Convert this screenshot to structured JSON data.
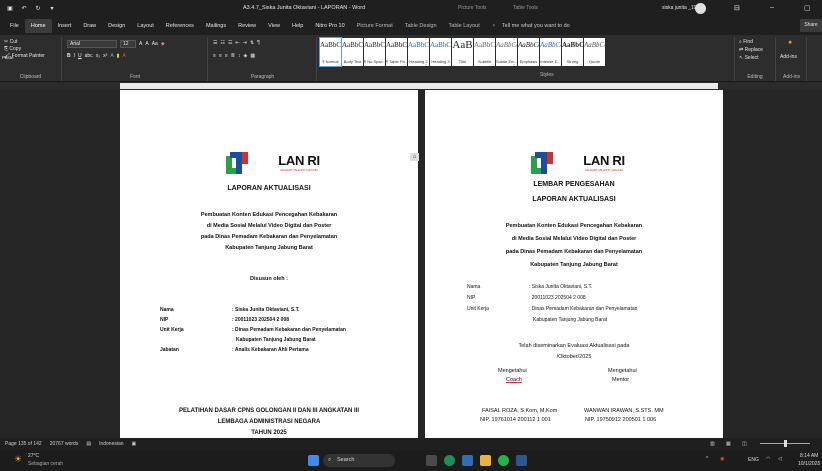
{
  "titlebar": {
    "document_title": "A3.4.7_Siska Junita Oktaviani - LAPORAN  -  Word",
    "picture_tools": "Picture Tools",
    "table_tools": "Table Tools",
    "user_name": "siska junita _19",
    "quick_access": [
      "save-icon",
      "undo-icon",
      "redo-icon",
      "more-icon"
    ]
  },
  "tabs": [
    "File",
    "Home",
    "Insert",
    "Draw",
    "Design",
    "Layout",
    "References",
    "Mailings",
    "Review",
    "View",
    "Help",
    "Nitro Pro 10",
    "Picture Format",
    "Table Design",
    "Table Layout"
  ],
  "active_tab": "Home",
  "tell_me": "Tell me what you want to do",
  "share": "Share",
  "ribbon": {
    "clipboard": {
      "label": "Clipboard",
      "paste": "Paste",
      "cut": "Cut",
      "copy": "Copy",
      "format_painter": "Format Painter"
    },
    "font": {
      "label": "Font",
      "name": "Arial",
      "size": "12"
    },
    "paragraph": {
      "label": "Paragraph"
    },
    "styles": {
      "label": "Styles",
      "items": [
        {
          "preview": "AaBbCcI",
          "name": "¶ Normal"
        },
        {
          "preview": "AaBbCc",
          "name": "Body Text"
        },
        {
          "preview": "AaBbCcI",
          "name": "¶ No Spac..."
        },
        {
          "preview": "AaBbCcI",
          "name": "¶ Table Pa..."
        },
        {
          "preview": "AaBbCc",
          "name": "Heading 2"
        },
        {
          "preview": "AaBbCc",
          "name": "Heading 3"
        },
        {
          "preview": "AaB",
          "name": "Title"
        },
        {
          "preview": "AaBbCc",
          "name": "Subtitle"
        },
        {
          "preview": "AaBbCcI",
          "name": "Subtle Em..."
        },
        {
          "preview": "AaBbCcI",
          "name": "Emphasis"
        },
        {
          "preview": "AaBbCcI",
          "name": "Intense E..."
        },
        {
          "preview": "AaBbCcI",
          "name": "Strong"
        },
        {
          "preview": "AaBbCcI",
          "name": "Quote"
        }
      ]
    },
    "editing": {
      "label": "Editing",
      "find": "Find",
      "replace": "Replace",
      "select": "Select"
    },
    "addins": {
      "label": "Add-ins",
      "button": "Add-ins"
    }
  },
  "page_left": {
    "logo_text": "LAN RI",
    "logo_tagline": "MAHARTI BHAKTI NAGARI",
    "heading": "LAPORAN AKTUALISASI",
    "subtitle_lines": [
      "Pembuatan Konten Edukasi Pencegahan Kebakaran",
      "di Media Sosial Melalui Video Digital dan Poster",
      "pada Dinas Pemadam Kebakaran dan Penyelamatan",
      "Kabupaten Tanjung Jabung Barat"
    ],
    "prepared_by": "Disusun oleh :",
    "fields": [
      {
        "label": "Nama",
        "value": ": Siska Junita Oktaviani, S.T."
      },
      {
        "label": "NIP",
        "value": ": 20011023 202504 2 008"
      },
      {
        "label": "Unit Kerja",
        "value": ": Dinas  Pemadam  Kebakaran  dan  Penyelamatan"
      },
      {
        "label": "",
        "value": "Kabupaten Tanjung Jabung Barat"
      },
      {
        "label": "Jabatan",
        "value": ": Analis Kebakaran Ahli Pertama"
      }
    ],
    "footer_lines": [
      "PELATIHAN DASAR CPNS GOLONGAN II DAN III ANGKATAN III",
      "LEMBAGA ADMINISTRASI NEGARA",
      "TAHUN 2025"
    ]
  },
  "page_right": {
    "logo_text": "LAN RI",
    "logo_tagline": "MAHARTI BHAKTI NAGARI",
    "heading1": "LEMBAR PENGESAHAN",
    "heading2": "LAPORAN AKTUALISASI",
    "subtitle_lines": [
      "Pembuatan Konten Edukasi Pencegahan Kebakaran",
      "di Media Sosial Melalui Video Digital dan Poster",
      "pada Dinas Pemadam Kebakaran dan Penyelamatan",
      "Kabupaten Tanjung Jabung Barat"
    ],
    "fields": [
      {
        "label": "Nama",
        "value": ": Siska Junita Oktaviani, S.T."
      },
      {
        "label": "NIP",
        "value": ": 20011023 202504 2 008"
      },
      {
        "label": "Unit Kerja",
        "value": ": Dinas   Pemadam   Kebakaran   dan   Penyelamatan"
      },
      {
        "label": "",
        "value": "Kabupaten Tanjung Jabung Barat"
      }
    ],
    "seminar_lines": [
      "Telah diseminarkan Evaluasi Aktualisasi pada",
      "/Oktober/2025"
    ],
    "sign_left_title": "Mengetahui",
    "sign_left_role": "Coach",
    "sign_right_title": "Mengetahui",
    "sign_right_role": "Mentor",
    "sign_left_name": "FAISAL ROZA, S.Kom, M.Kom",
    "sign_left_nip": "NIP. 19761014 200112 1 001",
    "sign_right_name": "WANWAN IRAWAN, S.STS. MM",
    "sign_right_nip": "NIP. 19750912 200501 1 006"
  },
  "statusbar": {
    "page": "Page 135 of 142",
    "words": "20767 words",
    "language": "Indonesian"
  },
  "taskbar": {
    "weather_temp": "27°C",
    "weather_desc": "Sebagian cerah",
    "search": "Search",
    "tray_lang": "ENG",
    "time": "8:14 AM",
    "date": "10/1/2025"
  },
  "colors": {
    "logo_blue": "#1a4fa0",
    "logo_green": "#2e9e48",
    "logo_red": "#d32f2f",
    "accent": "#4a90d9"
  }
}
